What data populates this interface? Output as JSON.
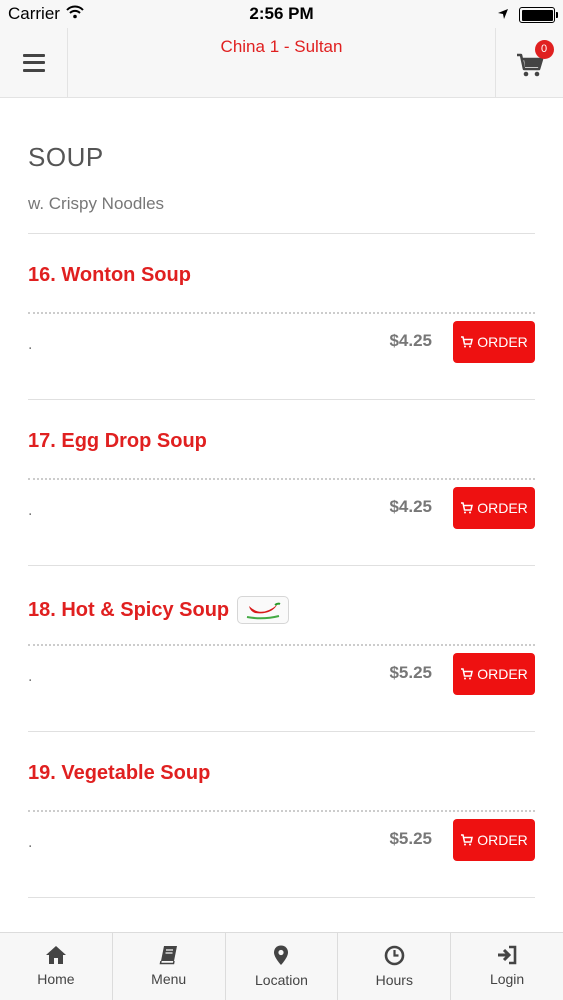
{
  "status_bar": {
    "carrier": "Carrier",
    "time": "2:56 PM"
  },
  "header": {
    "title": "China 1 - Sultan",
    "cart_count": "0"
  },
  "section": {
    "title": "SOUP",
    "subtitle": "w. Crispy Noodles"
  },
  "items": [
    {
      "name": "16. Wonton Soup",
      "description": ".",
      "price": "$4.25",
      "order_label": "ORDER",
      "spicy": false
    },
    {
      "name": "17. Egg Drop Soup",
      "description": ".",
      "price": "$4.25",
      "order_label": "ORDER",
      "spicy": false
    },
    {
      "name": "18. Hot & Spicy Soup",
      "description": ".",
      "price": "$5.25",
      "order_label": "ORDER",
      "spicy": true
    },
    {
      "name": "19. Vegetable Soup",
      "description": ".",
      "price": "$5.25",
      "order_label": "ORDER",
      "spicy": false
    }
  ],
  "bottom_nav": [
    {
      "label": "Home",
      "icon": "home-icon"
    },
    {
      "label": "Menu",
      "icon": "book-icon"
    },
    {
      "label": "Location",
      "icon": "map-pin-icon"
    },
    {
      "label": "Hours",
      "icon": "clock-icon"
    },
    {
      "label": "Login",
      "icon": "login-icon"
    }
  ],
  "colors": {
    "accent": "#e02020",
    "button": "#ee1111",
    "text_muted": "#777777",
    "bar_bg": "#f7f7f7"
  }
}
